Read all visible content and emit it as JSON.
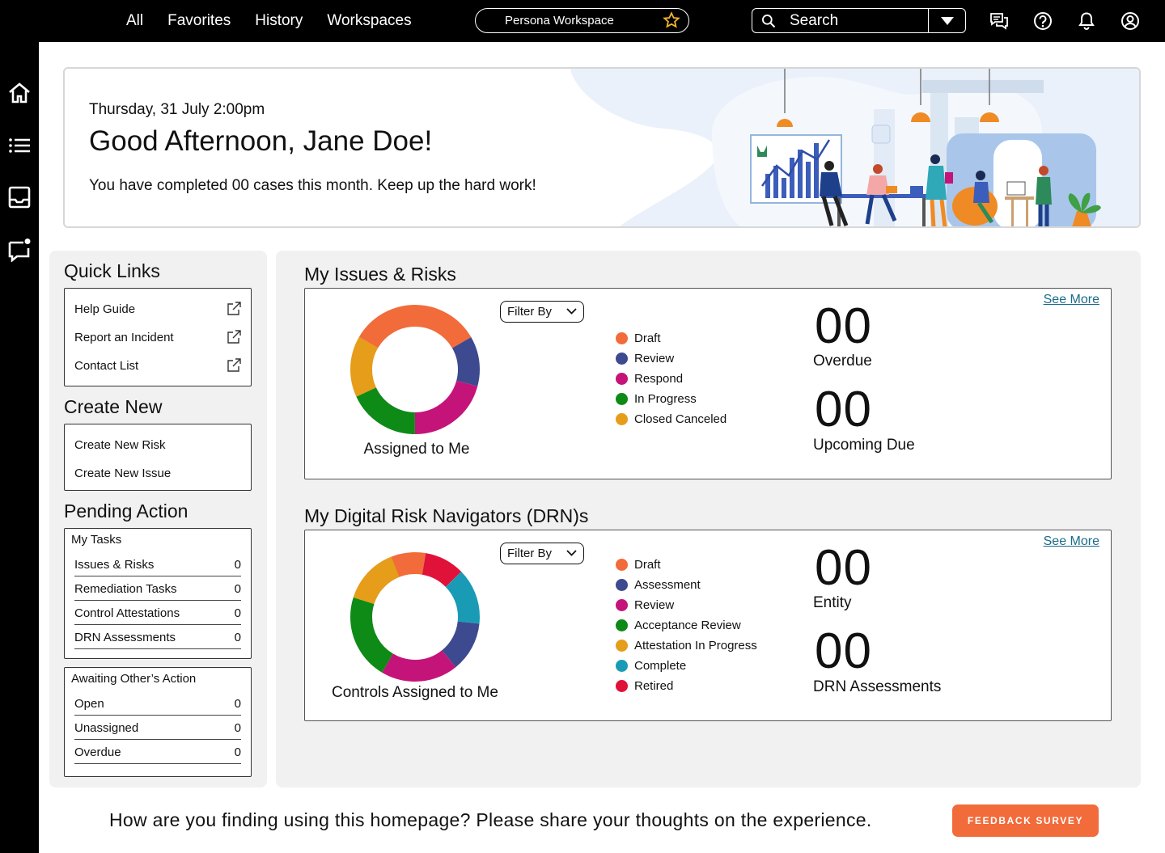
{
  "topnav": {
    "items": [
      "All",
      "Favorites",
      "History",
      "Workspaces"
    ],
    "workspace": "Persona Workspace",
    "search_label": "Search"
  },
  "icons": {
    "top": [
      "chat-icon",
      "help-icon",
      "bell-icon",
      "account-icon"
    ],
    "rail": [
      "home-icon",
      "list-icon",
      "inbox-icon",
      "message-icon"
    ]
  },
  "hero": {
    "date": "Thursday, 31 July 2:00pm",
    "greeting": "Good Afternoon, Jane Doe!",
    "message": "You have completed 00 cases this month. Keep up the hard work!"
  },
  "quick_links": {
    "title": "Quick Links",
    "items": [
      "Help Guide",
      "Report an Incident",
      "Contact List"
    ]
  },
  "create_new": {
    "title": "Create New",
    "items": [
      "Create New Risk",
      "Create New Issue"
    ]
  },
  "pending_action": {
    "title": "Pending Action",
    "my_tasks": {
      "header": "My Tasks",
      "rows": [
        {
          "label": "Issues & Risks",
          "count": "0"
        },
        {
          "label": "Remediation Tasks",
          "count": "0"
        },
        {
          "label": "Control Attestations",
          "count": "0"
        },
        {
          "label": "DRN Assessments",
          "count": "0"
        }
      ]
    },
    "awaiting": {
      "header": "Awaiting Other’s Action",
      "rows": [
        {
          "label": "Open",
          "count": "0"
        },
        {
          "label": "Unassigned",
          "count": "0"
        },
        {
          "label": "Overdue",
          "count": "0"
        }
      ]
    }
  },
  "issues": {
    "title": "My Issues & Risks",
    "filter": "Filter By",
    "see_more": "See More",
    "donut_label": "Assigned to Me",
    "legend": [
      {
        "label": "Draft",
        "color": "#f26b3a"
      },
      {
        "label": "Review",
        "color": "#3d4a8f"
      },
      {
        "label": "Respond",
        "color": "#c4147a"
      },
      {
        "label": "In Progress",
        "color": "#0e8a16"
      },
      {
        "label": "Closed Canceled",
        "color": "#e59d1a"
      }
    ],
    "stat1_value": "00",
    "stat1_label": "Overdue",
    "stat2_value": "00",
    "stat2_label": "Upcoming Due"
  },
  "drn": {
    "title": "My Digital Risk Navigators (DRN)s",
    "filter": "Filter By",
    "see_more": "See More",
    "donut_label": "Controls Assigned to Me",
    "legend": [
      {
        "label": "Draft",
        "color": "#f26b3a"
      },
      {
        "label": "Assessment",
        "color": "#3d4a8f"
      },
      {
        "label": "Review",
        "color": "#c4147a"
      },
      {
        "label": "Acceptance Review",
        "color": "#0e8a16"
      },
      {
        "label": "Attestation In Progress",
        "color": "#e59d1a"
      },
      {
        "label": "Complete",
        "color": "#1a9bb5"
      },
      {
        "label": "Retired",
        "color": "#e0123a"
      }
    ],
    "stat1_value": "00",
    "stat1_label": "Entity",
    "stat2_value": "00",
    "stat2_label": "DRN Assessments"
  },
  "footer": {
    "question": "How are you finding using this homepage? Please share your thoughts on the experience.",
    "button": "FEEDBACK SURVEY"
  }
}
